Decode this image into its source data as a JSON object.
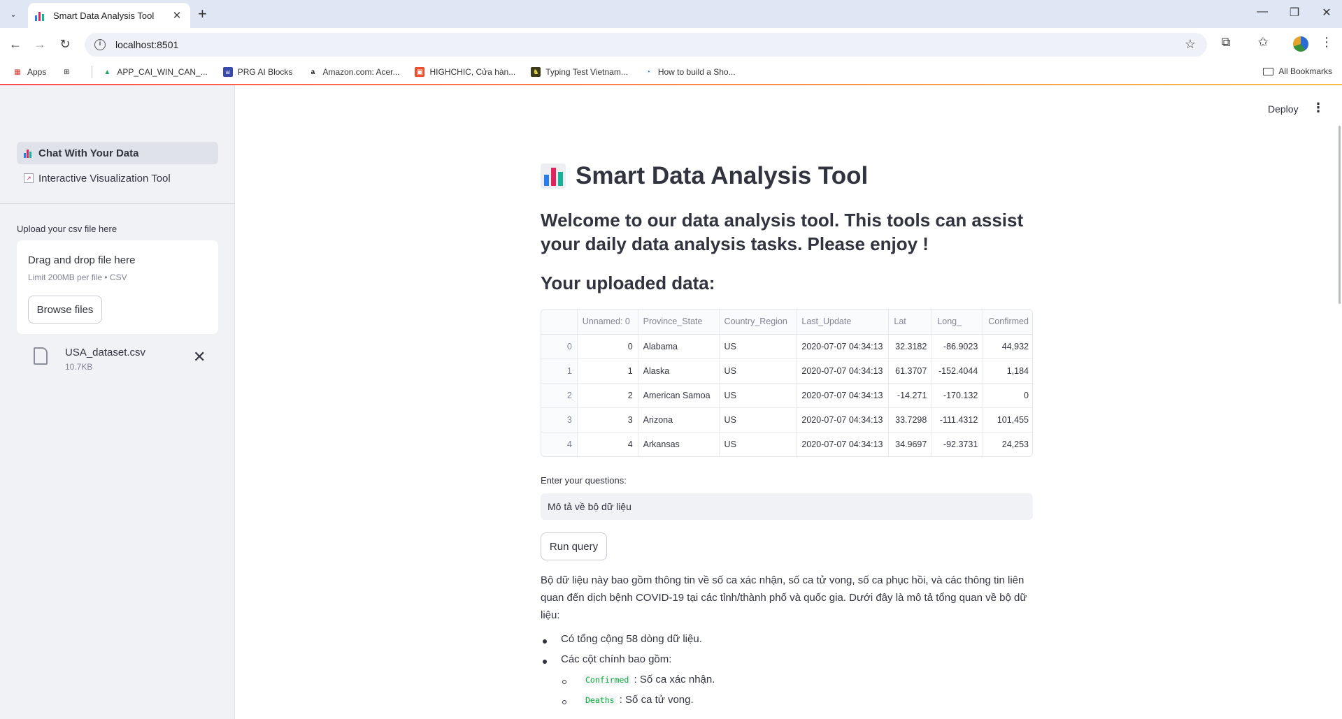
{
  "browser": {
    "tab_title": "Smart Data Analysis Tool",
    "url": "localhost:8501",
    "bookmarks": [
      {
        "label": "Apps",
        "icon": "apps-grid-icon"
      },
      {
        "label": "",
        "icon": "grid-icon"
      },
      {
        "label": "APP_CAI_WIN_CAN_...",
        "icon": "drive-icon"
      },
      {
        "label": "PRG AI Blocks",
        "icon": "prg-ai-icon"
      },
      {
        "label": "Amazon.com: Acer...",
        "icon": "amazon-icon"
      },
      {
        "label": "HIGHCHIC, Cửa hàn...",
        "icon": "shop-icon"
      },
      {
        "label": "Typing Test Vietnam...",
        "icon": "typing-icon"
      },
      {
        "label": "How to build a Sho...",
        "icon": "link-icon"
      }
    ],
    "all_bookmarks": "All Bookmarks"
  },
  "sidebar": {
    "nav": [
      {
        "label": "Chat With Your Data",
        "active": true
      },
      {
        "label": "Interactive Visualization Tool",
        "active": false
      }
    ],
    "upload_label": "Upload your csv file here",
    "dropzone_title": "Drag and drop file here",
    "dropzone_limit": "Limit 200MB per file • CSV",
    "browse_label": "Browse files",
    "file": {
      "name": "USA_dataset.csv",
      "size": "10.7KB"
    }
  },
  "header": {
    "deploy": "Deploy"
  },
  "main": {
    "title": "Smart Data Analysis Tool",
    "welcome": "Welcome to our data analysis tool. This tools can assist your daily data analysis tasks. Please enjoy !",
    "uploaded_heading": "Your uploaded data:",
    "table": {
      "columns": [
        "",
        "Unnamed: 0",
        "Province_State",
        "Country_Region",
        "Last_Update",
        "Lat",
        "Long_",
        "Confirmed"
      ],
      "rows": [
        [
          "0",
          "0",
          "Alabama",
          "US",
          "2020-07-07 04:34:13",
          "32.3182",
          "-86.9023",
          "44,932"
        ],
        [
          "1",
          "1",
          "Alaska",
          "US",
          "2020-07-07 04:34:13",
          "61.3707",
          "-152.4044",
          "1,184"
        ],
        [
          "2",
          "2",
          "American Samoa",
          "US",
          "2020-07-07 04:34:13",
          "-14.271",
          "-170.132",
          "0"
        ],
        [
          "3",
          "3",
          "Arizona",
          "US",
          "2020-07-07 04:34:13",
          "33.7298",
          "-111.4312",
          "101,455"
        ],
        [
          "4",
          "4",
          "Arkansas",
          "US",
          "2020-07-07 04:34:13",
          "34.9697",
          "-92.3731",
          "24,253"
        ]
      ]
    },
    "question_label": "Enter your questions:",
    "question_value": "Mô tả về bộ dữ liệu",
    "run_label": "Run query",
    "answer_paragraph": "Bộ dữ liệu này bao gồm thông tin về số ca xác nhận, số ca tử vong, số ca phục hồi, và các thông tin liên quan đến dịch bệnh COVID-19 tại các tỉnh/thành phố và quốc gia. Dưới đây là mô tả tổng quan về bộ dữ liệu:",
    "answer_items": {
      "rows_count": "Có tổng cộng 58 dòng dữ liệu.",
      "main_columns": "Các cột chính bao gồm:",
      "col1_code": "Confirmed",
      "col1_text": ": Số ca xác nhận.",
      "col2_code": "Deaths",
      "col2_text": ": Số ca tử vong."
    }
  },
  "colors": {
    "accent": "#ff4b4b",
    "code_green": "#09ab3b",
    "sidebar_bg": "#f0f2f6"
  }
}
